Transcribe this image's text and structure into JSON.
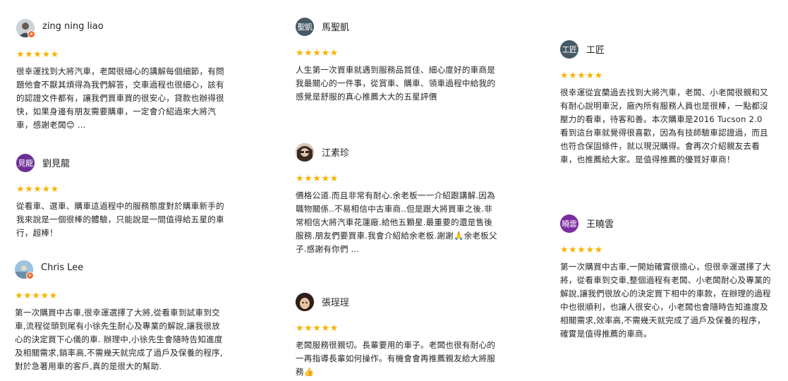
{
  "reviews": [
    {
      "name": "zing ning liao",
      "avatar_text": "",
      "avatar_kind": "photo-person",
      "avatar_color": "#9aa7b0",
      "stars": "★★★★★",
      "text": "很幸運找到大將汽車，老闆很細心的講解每個細節，有問題他會不厭其煩得為我們解答，交車過程也很細心，該有的認證文件都有，讓我們買車買的很安心，貸款也辦得很快，如果身邊有朋友需要購車，一定會介紹過來大將汽車，感謝老闆😊 ..."
    },
    {
      "name": "劉見龍",
      "avatar_text": "見龍",
      "avatar_kind": "initials",
      "avatar_color": "#6d2e94",
      "stars": "★★★★★",
      "text": "從看車、選車、購車這過程中的服務態度對於購車新手的我來說是一個很棒的體驗，只能說是一間值得給五星的車行，超棒！"
    },
    {
      "name": "Chris Lee",
      "avatar_text": "",
      "avatar_kind": "photo-landscape",
      "avatar_color": "#7fa7c9",
      "stars": "★★★★★",
      "text": "第一次購買中古車,很幸運選擇了大將,從看車到試車到交車,流程從頭到尾有小徐先生耐心及專業的解說,讓我很放心的決定買下心儀的車. 辦理中,小徐先生會隨時告知進度及相關需求,銷率高,不需幾天就完成了過戶及保養的程序,對於急著用車的客戶,真的是很大的幫助."
    },
    {
      "name": "馬聖凱",
      "avatar_text": "聖凱",
      "avatar_kind": "initials",
      "avatar_color": "#455a64",
      "stars": "★★★★★",
      "text": "人生第一次買車就遇到服務品質佳、細心度好的車商是我最關心的一件事，從賞車、購車、領車過程中給我的感覺是舒服的真心推薦大大的五星評價"
    },
    {
      "name": "江素珍",
      "avatar_text": "",
      "avatar_kind": "photo-glasses",
      "avatar_color": "#5b4a3a",
      "stars": "★★★★★",
      "text": "價格公道.而且非常有耐心.余老板一一介紹跟講解.因為職物關係..不易相信中古車商..但是跟大將買車之後.非常相信大將汽車花蓮廠.給他五顆星.最重要的還是售後服務.朋友們要買車.我會介紹給余老板.謝謝🙏余老板父子.感謝有你們 ..."
    },
    {
      "name": "張珵珵",
      "avatar_text": "",
      "avatar_kind": "photo-child",
      "avatar_color": "#3b2a22",
      "stars": "★★★★★",
      "text": "老闆服務很親切。長輩要用的車子。老闆也很有耐心的一再指導長輩如何操作。有機會會再推薦親友給大將服務👍"
    },
    {
      "name": "工匠",
      "avatar_text": "工匠",
      "avatar_kind": "initials",
      "avatar_color": "#455a64",
      "stars": "★★★★★",
      "text": "很幸運從宜蘭過去找到大將汽車，老闆、小老闆很親和又有耐心說明車況，廠內所有服務人員也是很棒，一點都沒壓力的看車，待客和善。本次購車是2016 Tucson 2.0 看到這台車就覺得很喜歡，因為有技師驗車認證過，而且也符合保固條件，就以現況購得。會再次介紹親友去看車，也推薦給大家。是值得推薦的優質好車商！"
    },
    {
      "name": "王曉雲",
      "avatar_text": "曉雲",
      "avatar_kind": "initials",
      "avatar_color": "#7b2d9e",
      "stars": "★★★★★",
      "text": "第一次購買中古車,一開始確實很擔心，但很幸運選擇了大將，從看車到交車,整個過程有老闆、小老闆耐心及專業的解說,讓我們很放心的決定買下相中的車款，在辦理的過程中也很順利，也讓人很安心，小老闆也會隨時告知進度及相關需求,效率高,不需幾天就完成了過戶及保養的程序，確實是值得推薦的車商。"
    }
  ]
}
